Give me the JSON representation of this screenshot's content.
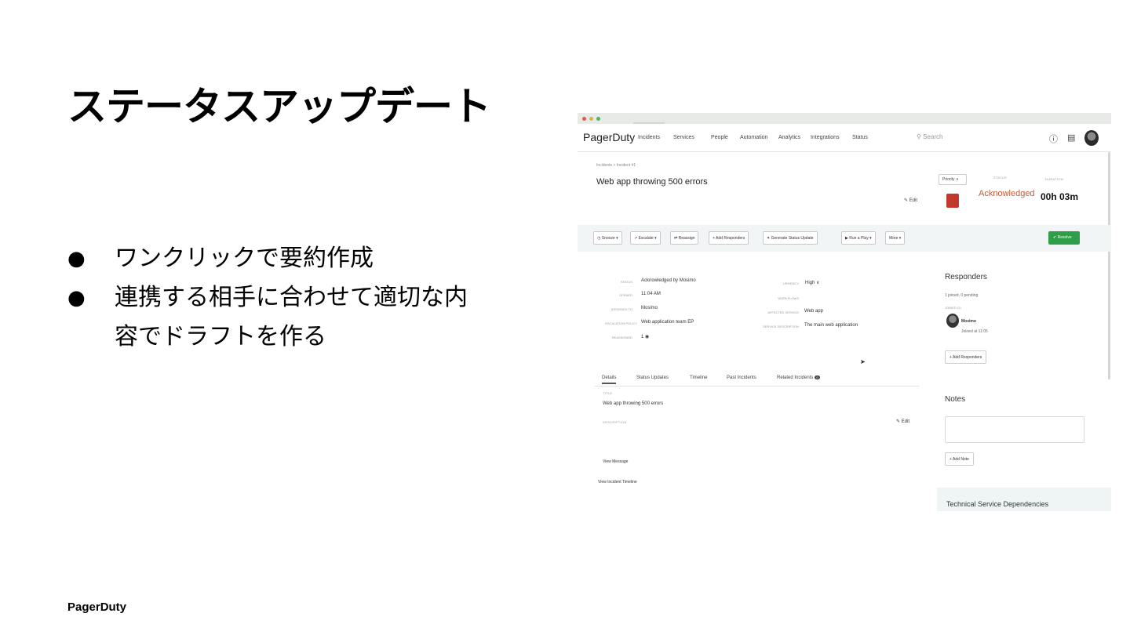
{
  "slide": {
    "title": "ステータスアップデート",
    "bullet_symbol": "●",
    "bullets": [
      "ワンクリックで要約作成",
      "連携する相手に合わせて適切な内",
      "容でドラフトを作る"
    ],
    "footer": "PagerDuty"
  },
  "screenshot": {
    "brand": "PagerDuty",
    "nav": [
      "Incidents",
      "Services",
      "People",
      "Automation",
      "Analytics",
      "Integrations",
      "Status"
    ],
    "search_placeholder": "Search",
    "breadcrumb": "Incidents > Incident #1",
    "incident_title": "Web app throwing 500 errors",
    "edit_label": "Edit",
    "priority_label": "Priority ∨",
    "status_label": "STATUS",
    "status_value": "Acknowledged",
    "duration_label": "DURATION",
    "duration_value": "00h 03m",
    "actions": [
      "Snooze ▾",
      "Escalate ▾",
      "Reassign",
      "Add Responders",
      "Generate Status Update",
      "Run a Play ▾",
      "More ▾"
    ],
    "resolve_label": "✔ Resolve",
    "fields_left": [
      {
        "label": "STATUS",
        "value": "Acknowledged by Mosimo"
      },
      {
        "label": "OPENED",
        "value": "11:04 AM"
      },
      {
        "label": "ASSIGNED TO",
        "value": "Mosimo"
      },
      {
        "label": "ESCALATION POLICY",
        "value": "Web application team EP"
      },
      {
        "label": "REASSIGNED",
        "value": "1"
      }
    ],
    "fields_right": [
      {
        "label": "URGENCY",
        "value": "High ∨"
      },
      {
        "label": "WORKFLOWS",
        "value": ""
      },
      {
        "label": "AFFECTED SERVICE",
        "value": "Web app"
      },
      {
        "label": "SERVICE DESCRIPTION",
        "value": "The main web application"
      }
    ],
    "responders_title": "Responders",
    "responders_summary": "1 joined, 0 pending",
    "responders_joined_label": "JOINED (1)",
    "responder_name": "Mosimo",
    "responder_joined": "Joined at 11:05",
    "add_responders_label": "Add Responders",
    "notes_title": "Notes",
    "add_note_label": "+ Add Note",
    "tech_title": "Technical Service Dependencies",
    "tabs": [
      "Details",
      "Status Updates",
      "Timeline",
      "Past Incidents",
      "Related Incidents"
    ],
    "related_count": "0",
    "details": {
      "title_label": "TITLE",
      "title_value": "Web app throwing 500 errors",
      "description_label": "DESCRIPTION",
      "edit_label": "Edit",
      "view_message": "View Message",
      "view_timeline": "View Incident Timeline"
    },
    "colors": {
      "priority": "#c0392b",
      "status": "#c45c3a",
      "resolve": "#2e9e48"
    }
  }
}
